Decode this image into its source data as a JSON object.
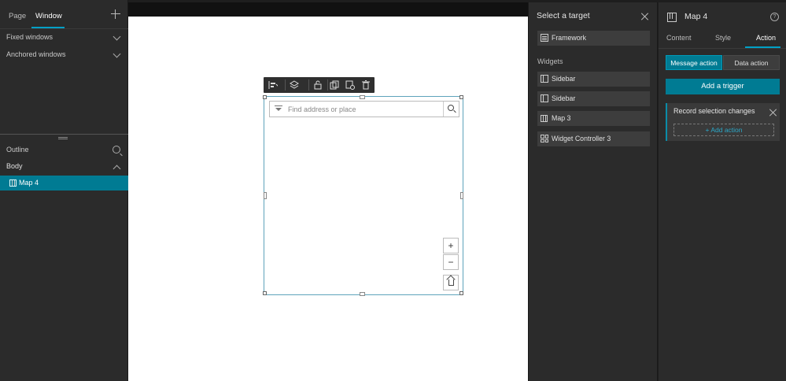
{
  "left_panel": {
    "tabs": [
      {
        "label": "Page"
      },
      {
        "label": "Window"
      }
    ],
    "add_icon": "plus-icon",
    "sections": [
      {
        "label": "Fixed windows"
      },
      {
        "label": "Anchored windows"
      }
    ],
    "outline": {
      "label": "Outline",
      "body_label": "Body",
      "selected_item": "Map 4"
    }
  },
  "canvas": {
    "search_placeholder": "Find address or place",
    "zoom_in": "+",
    "zoom_out": "−",
    "toolbar_icons": [
      "align-icon",
      "layers-icon",
      "unlock-icon",
      "duplicate-icon",
      "copy-style-icon",
      "delete-icon"
    ]
  },
  "target_panel": {
    "title": "Select a target",
    "framework": "Framework",
    "widgets_label": "Widgets",
    "widgets": [
      {
        "label": "Sidebar",
        "icon": "sidebar-icon"
      },
      {
        "label": "Sidebar",
        "icon": "sidebar-icon"
      },
      {
        "label": "Map 3",
        "icon": "map-icon"
      },
      {
        "label": "Widget Controller 3",
        "icon": "widget-controller-icon"
      }
    ]
  },
  "settings_panel": {
    "title": "Map 4",
    "tabs": [
      {
        "label": "Content"
      },
      {
        "label": "Style"
      },
      {
        "label": "Action"
      }
    ],
    "segments": [
      {
        "label": "Message action"
      },
      {
        "label": "Data action"
      }
    ],
    "trigger_button": "Add a trigger",
    "trigger_card": {
      "title": "Record selection changes",
      "add_action": "+ Add action"
    }
  },
  "colors": {
    "accent": "#007b93",
    "panel": "#2b2b2b",
    "canvas": "#ffffff"
  }
}
